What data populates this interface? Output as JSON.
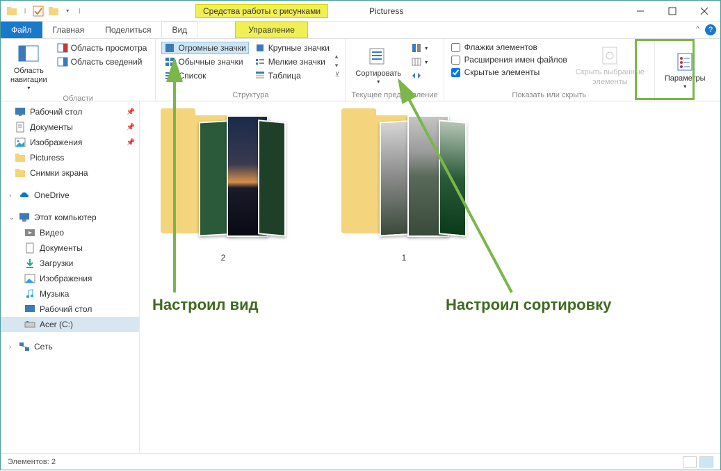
{
  "window": {
    "tool_context": "Средства работы с рисунками",
    "tool_subtab": "Управление",
    "title": "Picturess"
  },
  "tabs": {
    "file": "Файл",
    "home": "Главная",
    "share": "Поделиться",
    "view": "Вид"
  },
  "ribbon": {
    "regions": {
      "nav_pane": "Область\nнавигации",
      "preview_pane": "Область просмотра",
      "details_pane": "Область сведений",
      "label": "Области"
    },
    "layout": {
      "extra_large": "Огромные значки",
      "large": "Крупные значки",
      "medium": "Обычные значки",
      "small": "Мелкие значки",
      "list": "Список",
      "details": "Таблица",
      "label": "Структура"
    },
    "sort": {
      "sort_by": "Сортировать",
      "label": "Текущее представление"
    },
    "show": {
      "checkboxes": "Флажки элементов",
      "extensions": "Расширения имен файлов",
      "hidden": "Скрытые элементы",
      "hide_selected": "Скрыть выбранные\nэлементы",
      "label": "Показать или скрыть"
    },
    "options": {
      "options": "Параметры"
    }
  },
  "tree": {
    "quick": [
      {
        "label": "Рабочий стол",
        "pinned": true
      },
      {
        "label": "Документы",
        "pinned": true
      },
      {
        "label": "Изображения",
        "pinned": true
      },
      {
        "label": "Picturess",
        "pinned": false
      },
      {
        "label": "Снимки экрана",
        "pinned": false
      }
    ],
    "onedrive": "OneDrive",
    "this_pc": "Этот компьютер",
    "pc_items": [
      "Видео",
      "Документы",
      "Загрузки",
      "Изображения",
      "Музыка",
      "Рабочий стол",
      "Acer (C:)"
    ],
    "network": "Сеть"
  },
  "folders": [
    {
      "name": "2"
    },
    {
      "name": "1"
    }
  ],
  "status": {
    "items": "Элементов: 2"
  },
  "annotations": {
    "view": "Настроил вид",
    "sort": "Настроил сортировку"
  }
}
